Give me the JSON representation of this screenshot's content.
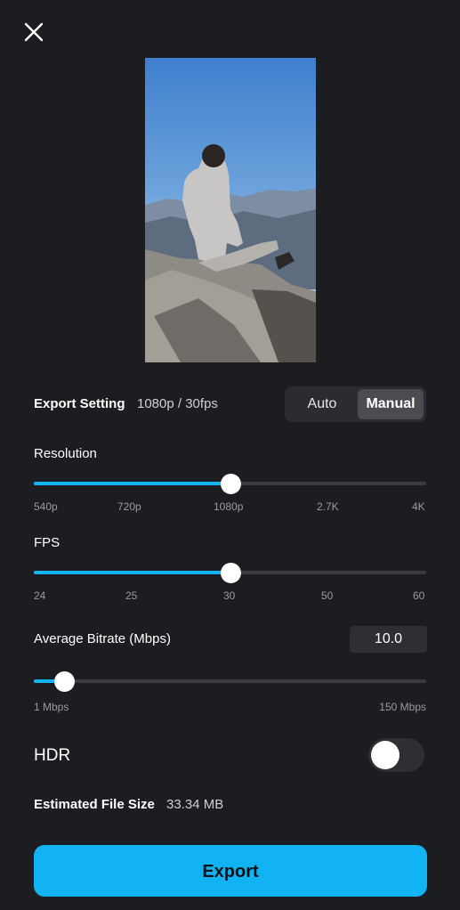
{
  "close": {
    "icon": "close-icon"
  },
  "preview": {
    "icon": "video-preview-thumbnail"
  },
  "export_setting": {
    "label": "Export Setting",
    "value": "1080p / 30fps",
    "modes": [
      "Auto",
      "Manual"
    ],
    "selected_mode": "Manual"
  },
  "resolution": {
    "label": "Resolution",
    "ticks": [
      "540p",
      "720p",
      "1080p",
      "2.7K",
      "4K"
    ],
    "selected": "1080p",
    "level": 0.5
  },
  "fps": {
    "label": "FPS",
    "ticks": [
      "24",
      "25",
      "30",
      "50",
      "60"
    ],
    "selected": "30",
    "level": 0.5
  },
  "bitrate": {
    "label": "Average Bitrate (Mbps)",
    "value": "10.0",
    "min_label": "1 Mbps",
    "max_label": "150 Mbps",
    "level": 0.077
  },
  "hdr": {
    "label": "HDR",
    "enabled": false
  },
  "file_size": {
    "label": "Estimated File Size",
    "value": "33.34 MB"
  },
  "export_button": {
    "label": "Export"
  },
  "colors": {
    "accent": "#12b3f2",
    "background": "#1c1d21",
    "track": "#3a3b40"
  }
}
